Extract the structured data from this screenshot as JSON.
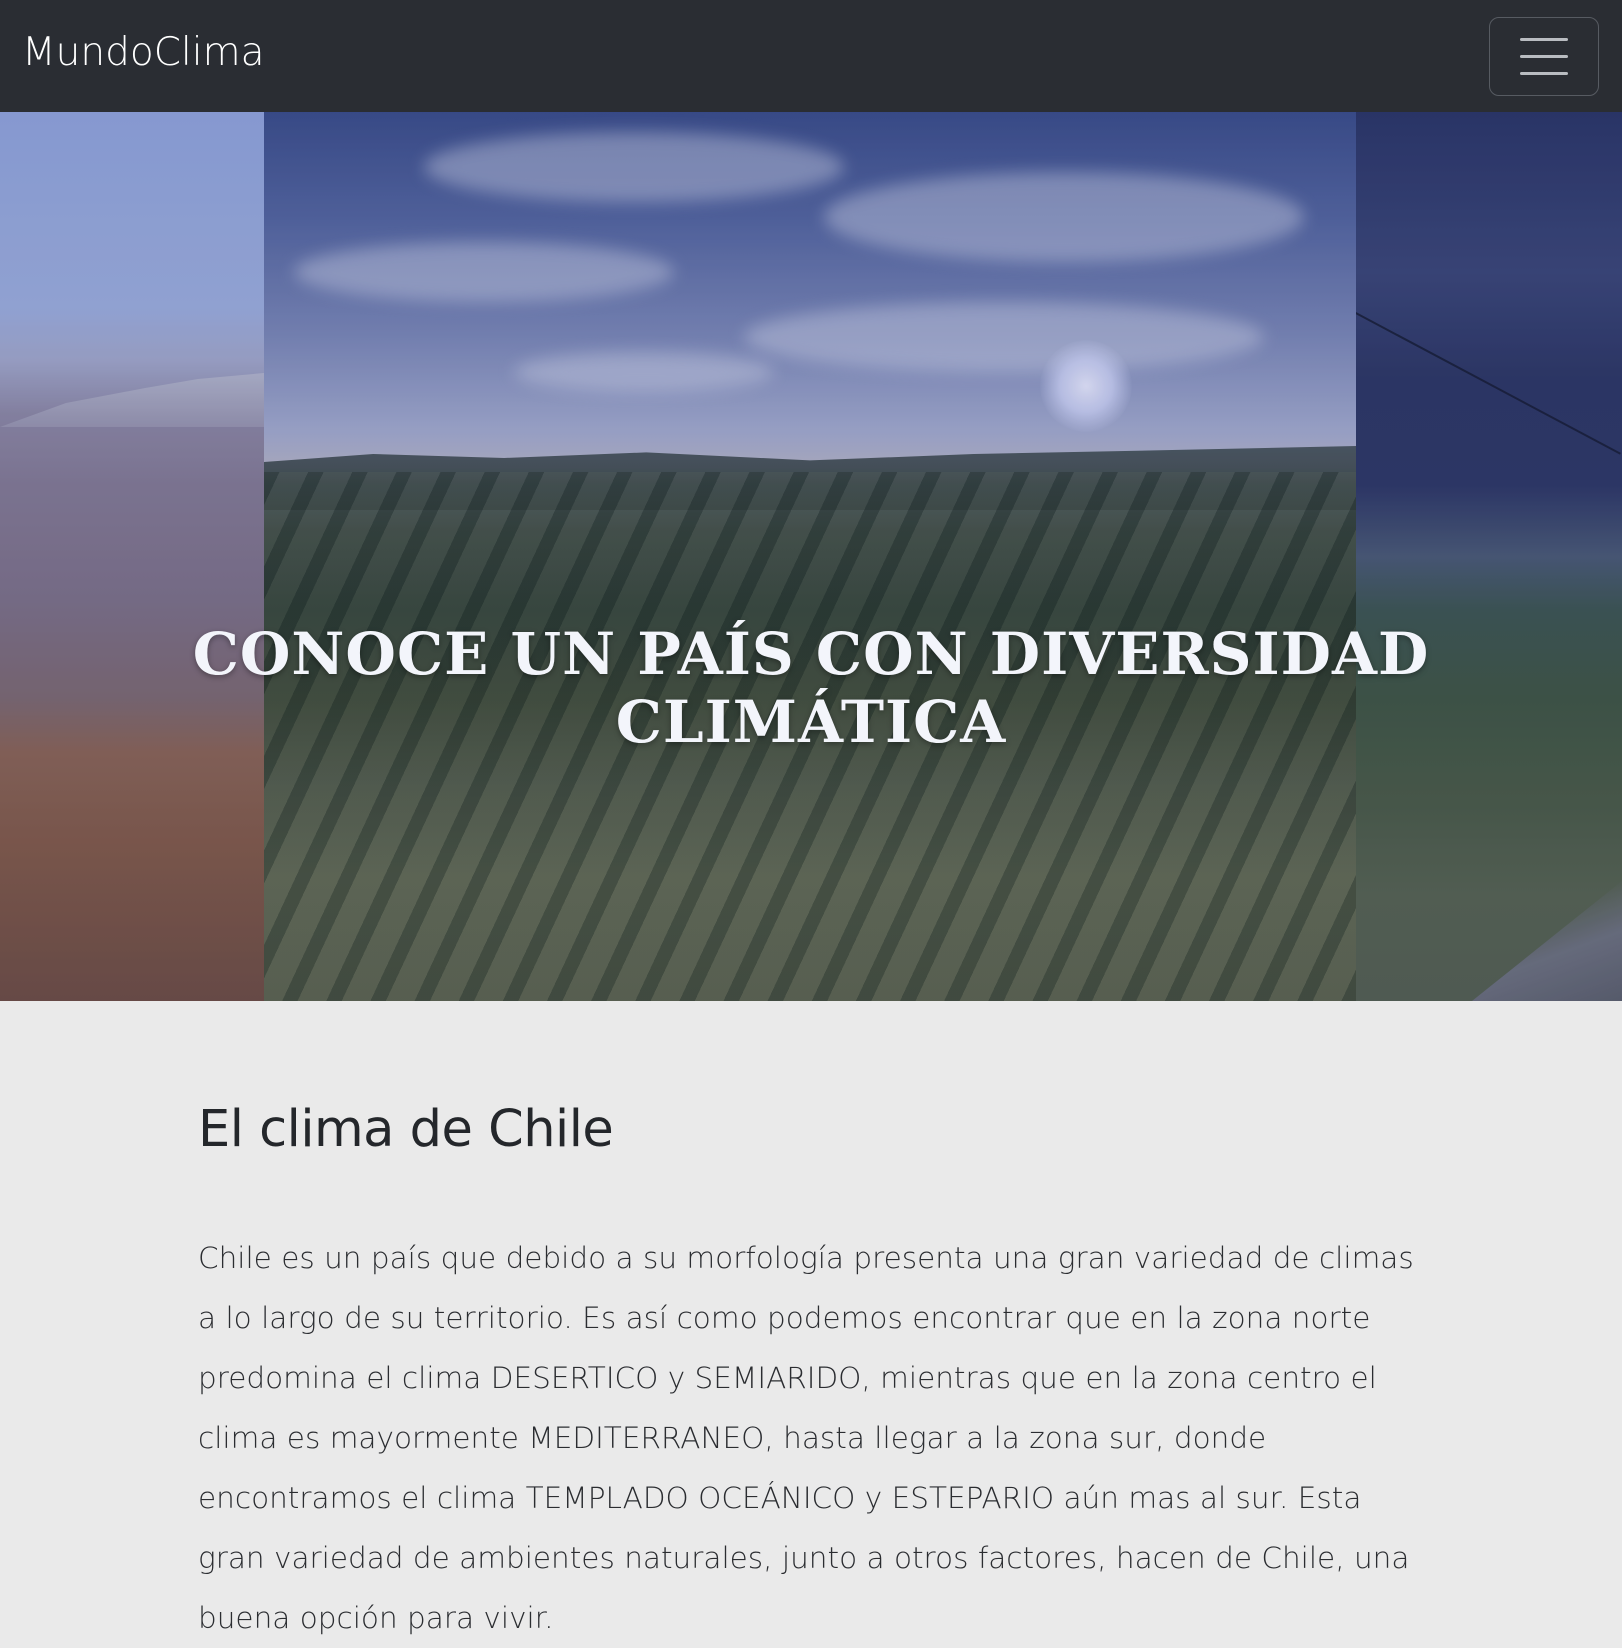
{
  "navbar": {
    "brand": "MundoClima",
    "toggler_icon": "hamburger-menu-icon"
  },
  "hero": {
    "title": "CONOCE UN PAÍS CON DIVERSIDAD CLIMÁTICA",
    "panels": [
      "desert-landscape",
      "vineyard-sunrise",
      "stormy-countryside"
    ]
  },
  "content": {
    "heading": "El clima de Chile",
    "paragraph": "Chile es un país que debido a su morfología presenta una gran variedad de climas a lo largo de su territorio. Es así como podemos encontrar que en la zona norte predomina el clima DESERTICO y SEMIARIDO, mientras que en la zona centro el clima es mayormente MEDITERRANEO, hasta llegar a la zona sur, donde encontramos el clima TEMPLADO OCEÁNICO y ESTEPARIO aún mas al sur. Esta gran variedad de ambientes naturales, junto a otros factores, hacen de Chile, una buena opción para vivir."
  },
  "colors": {
    "navbar_bg": "#2a2d33",
    "page_bg": "#eaeaea",
    "text": "#24272b"
  }
}
